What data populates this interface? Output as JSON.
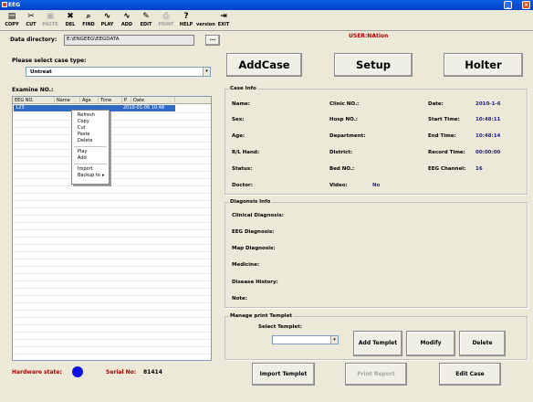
{
  "window": {
    "title": "EEG"
  },
  "toolbar": {
    "items": [
      {
        "label": "COPY",
        "icon": "copy-icon",
        "glyph": "▤",
        "enabled": true
      },
      {
        "label": "CUT",
        "icon": "cut-icon",
        "glyph": "✂",
        "enabled": true
      },
      {
        "label": "PASTE",
        "icon": "paste-icon",
        "glyph": "▣",
        "enabled": false
      },
      {
        "label": "DEL",
        "icon": "delete-icon",
        "glyph": "✖",
        "enabled": true
      },
      {
        "label": "FIND",
        "icon": "find-icon",
        "glyph": "⌕",
        "enabled": true
      },
      {
        "label": "PLAY",
        "icon": "play-waveform-icon",
        "glyph": "∿",
        "enabled": true
      },
      {
        "label": "ADD",
        "icon": "add-waveform-icon",
        "glyph": "∿",
        "enabled": true
      },
      {
        "label": "EDIT",
        "icon": "edit-icon",
        "glyph": "✎",
        "enabled": true
      },
      {
        "label": "PRINT",
        "icon": "print-icon",
        "glyph": "⎙",
        "enabled": false
      },
      {
        "label": "HELP",
        "icon": "help-icon",
        "glyph": "?",
        "enabled": true
      },
      {
        "label": "version",
        "icon": "version-icon",
        "glyph": "",
        "enabled": true
      },
      {
        "label": "EXIT",
        "icon": "exit-icon",
        "glyph": "⇥",
        "enabled": true
      }
    ]
  },
  "left": {
    "data_dir_label": "Data directory:",
    "data_dir_value": "E:\\ENGEEG\\EEGDATA",
    "browse_label": "...",
    "case_type_label": "Please select case type:",
    "case_type_value": "Untreat",
    "examine_label": "Examine NO.:",
    "columns": [
      "EEG NO.",
      "Name",
      "Age",
      "Time",
      "P",
      "Date"
    ],
    "rows": [
      {
        "eeg_no": "123",
        "name": "",
        "age": "",
        "time": "",
        "p": "",
        "date": "2010-01-06 10:48"
      }
    ]
  },
  "context_menu": {
    "items": [
      "Refresh",
      "Copy",
      "Cut",
      "Paste",
      "Delete",
      "Play",
      "Add",
      "Import",
      "Backup to"
    ],
    "submenu_arrow": "▸"
  },
  "user": {
    "label": "USER:NAtion"
  },
  "actions": {
    "add_case": "AddCase",
    "setup": "Setup",
    "holter": "Holter"
  },
  "case_info": {
    "title": "Case Info",
    "name_label": "Name:",
    "sex_label": "Sex:",
    "age_label": "Age:",
    "hand_label": "R/L Hand:",
    "status_label": "Status:",
    "doctor_label": "Doctor:",
    "clinic_label": "Clinic NO.:",
    "hosp_label": "Hosp NO.:",
    "department_label": "Department:",
    "district_label": "District:",
    "bed_label": "Bed NO.:",
    "video_label": "Video:",
    "video_value": "No",
    "date_label": "Date:",
    "date_value": "2010-1-6",
    "start_label": "Start Time:",
    "start_value": "10:48:11",
    "end_label": "End Time:",
    "end_value": "10:48:14",
    "record_label": "Record Time:",
    "record_value": "00:00:00",
    "channel_label": "EEG Channel:",
    "channel_value": "16"
  },
  "diagnosis": {
    "title": "Diagonsis Info",
    "clinical": "Clinical Diagnosis:",
    "eeg": "EEG Diagnosis:",
    "map": "Map Diagnosis:",
    "medicine": "Medicine:",
    "history": "Disease History:",
    "note": "Note:"
  },
  "templet": {
    "title": "Manage print Templet",
    "select_label": "Select Templet:",
    "select_value": "",
    "add": "Add Templet",
    "modify": "Modify",
    "delete": "Delete"
  },
  "footer": {
    "hardware_label": "Hardware state:",
    "serial_label": "Serial No:",
    "serial_value": "81414",
    "import": "Import Templet",
    "print_report": "Print Report",
    "edit_case": "Edit Case"
  },
  "colors": {
    "accent_red": "#b00000",
    "status_blue": "#1010e0",
    "value_blue": "#202090",
    "selection": "#316ac5"
  }
}
